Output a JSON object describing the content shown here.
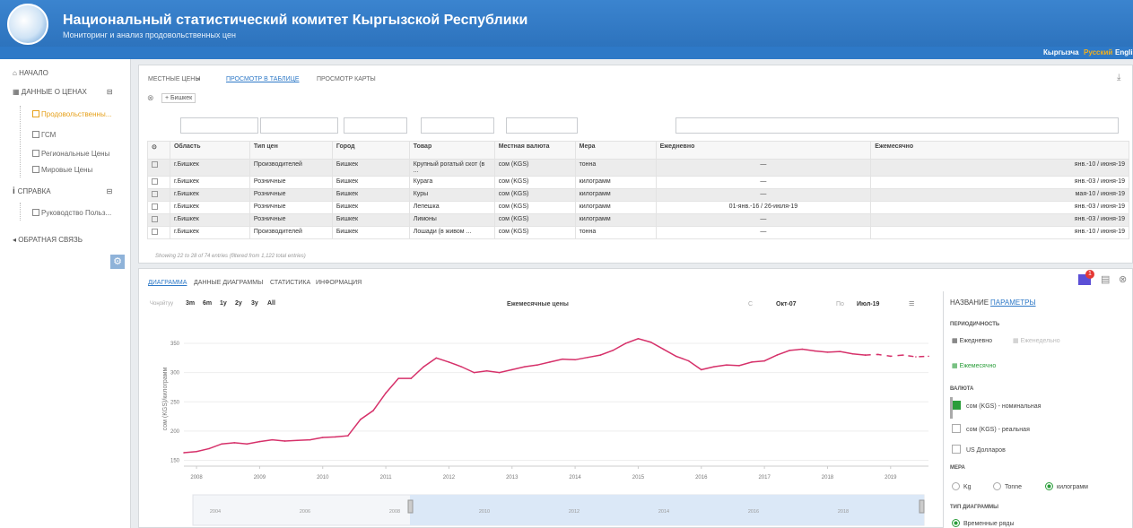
{
  "header": {
    "title": "Национальный статистический комитет Кыргызской Республики",
    "subtitle": "Мониторинг и анализ продовольственных цен"
  },
  "languages": [
    "Кыргызча",
    "Русский",
    "English"
  ],
  "sidebar": {
    "home": "НАЧАЛО",
    "prices": "ДАННЫЕ О ЦЕНАХ",
    "food": "Продовольственны...",
    "fuel": "ГСМ",
    "regional": "Региональные Цены",
    "world": "Мировые Цены",
    "help": "СПРАВКА",
    "guide": "Руководство Польз...",
    "feedback": "ОБРАТНАЯ СВЯЗЬ"
  },
  "breadcrumb": {
    "local": "МЕСТНЫЕ ЦЕНЫ",
    "sep": "»",
    "table": "ПРОСМОТР В ТАБЛИЦЕ",
    "map": "ПРОСМОТР КАРТЫ"
  },
  "filter_chip": "+ Бишкек",
  "table": {
    "columns": [
      "Область",
      "Тип цен",
      "Город",
      "Товар",
      "Местная валюта",
      "Мера",
      "Ежедневно",
      "Ежемесячно"
    ],
    "rows": [
      [
        "г.Бишкек",
        "Производителей",
        "Бишкек",
        "Крупный рогатый скот (в ...",
        "сом (KGS)",
        "тонна",
        "—",
        "янв.-10 / июня-19"
      ],
      [
        "г.Бишкек",
        "Розничные",
        "Бишкек",
        "Курага",
        "сом (KGS)",
        "килограмм",
        "—",
        "янв.-03 / июня-19"
      ],
      [
        "г.Бишкек",
        "Розничные",
        "Бишкек",
        "Куры",
        "сом (KGS)",
        "килограмм",
        "—",
        "мая-10 / июня-19"
      ],
      [
        "г.Бишкек",
        "Розничные",
        "Бишкек",
        "Лепешка",
        "сом (KGS)",
        "килограмм",
        "01-янв.-16 / 26-июля-19",
        "янв.-03 / июня-19"
      ],
      [
        "г.Бишкек",
        "Розничные",
        "Бишкек",
        "Лимоны",
        "сом (KGS)",
        "килограмм",
        "—",
        "янв.-03 / июня-19"
      ],
      [
        "г.Бишкек",
        "Производителей",
        "Бишкек",
        "Лошади (в живом ...",
        "сом (KGS)",
        "тонна",
        "—",
        "янв.-10 / июня-19"
      ]
    ],
    "footer": "Showing 22 to 28 of 74 entries (filtered from 1,122 total entries)"
  },
  "chart_tabs": [
    "ДИАГРАММА",
    "ДАННЫЕ ДИАГРАММЫ",
    "СТАТИСТИКА",
    "ИНФОРМАЦИЯ"
  ],
  "badge": "1",
  "chart_controls": {
    "zoom_label": "Чоңойтуу",
    "ranges": [
      "3m",
      "6m",
      "1y",
      "2y",
      "3y",
      "All"
    ],
    "from_label": "С",
    "from": "Окт-07",
    "to_label": "По",
    "to": "Июл-19"
  },
  "chart_data": {
    "type": "line",
    "title": "Ежемесячные цены",
    "ylabel": "сом (KGS)/килограмм",
    "xlabel": "",
    "ylim": [
      140,
      370
    ],
    "xlim": [
      2007.8,
      2019.6
    ],
    "yticks": [
      150,
      200,
      250,
      300,
      350
    ],
    "xticks": [
      2008,
      2009,
      2010,
      2011,
      2012,
      2013,
      2014,
      2015,
      2016,
      2017,
      2018,
      2019
    ],
    "grid": true,
    "series": [
      {
        "color": "#d6316a",
        "x": [
          2007.8,
          2008.0,
          2008.2,
          2008.4,
          2008.6,
          2008.8,
          2009.0,
          2009.2,
          2009.4,
          2009.6,
          2009.8,
          2010.0,
          2010.2,
          2010.4,
          2010.6,
          2010.8,
          2011.0,
          2011.2,
          2011.4,
          2011.6,
          2011.8,
          2012.0,
          2012.2,
          2012.4,
          2012.6,
          2012.8,
          2013.0,
          2013.2,
          2013.4,
          2013.6,
          2013.8,
          2014.0,
          2014.2,
          2014.4,
          2014.6,
          2014.8,
          2015.0,
          2015.2,
          2015.4,
          2015.6,
          2015.8,
          2016.0,
          2016.2,
          2016.4,
          2016.6,
          2016.8,
          2017.0,
          2017.2,
          2017.4,
          2017.6,
          2017.8,
          2018.0,
          2018.2,
          2018.4,
          2018.6
        ],
        "values": [
          163,
          165,
          170,
          178,
          180,
          178,
          182,
          185,
          183,
          184,
          185,
          189,
          190,
          192,
          220,
          235,
          265,
          290,
          290,
          310,
          325,
          318,
          310,
          300,
          303,
          300,
          305,
          310,
          313,
          318,
          323,
          322,
          326,
          330,
          338,
          350,
          358,
          352,
          340,
          328,
          320,
          305,
          310,
          313,
          312,
          318,
          320,
          330,
          338,
          340,
          337,
          335,
          336,
          332,
          330
        ]
      },
      {
        "color": "#d6316a",
        "dashed": true,
        "x": [
          2018.6,
          2018.8,
          2019.0,
          2019.2,
          2019.4,
          2019.6
        ],
        "values": [
          330,
          331,
          328,
          330,
          327,
          328
        ]
      }
    ],
    "navigator": {
      "xticks": [
        2006,
        2008,
        2010,
        2012,
        2014,
        2016,
        2018
      ],
      "extra_tick": 2004
    }
  },
  "right_panel": {
    "tab_name": "НАЗВАНИЕ",
    "tab_params": "ПАРАМЕТРЫ",
    "periodicity": "ПЕРИОДИЧНОСТЬ",
    "daily": "Ежедневно",
    "weekly": "Еженедельно",
    "monthly": "Ежемесячно",
    "currency": "ВАЛЮТА",
    "cur1": "сом (KGS) - номинальная",
    "cur2": "сом (KGS) - реальная",
    "cur3": "US Долларов",
    "measure": "МЕРА",
    "m1": "Kg",
    "m2": "Tonne",
    "m3": "килограмм",
    "chart_type": "ТИП ДИАГРАММЫ",
    "ct1": "Временные ряды"
  }
}
